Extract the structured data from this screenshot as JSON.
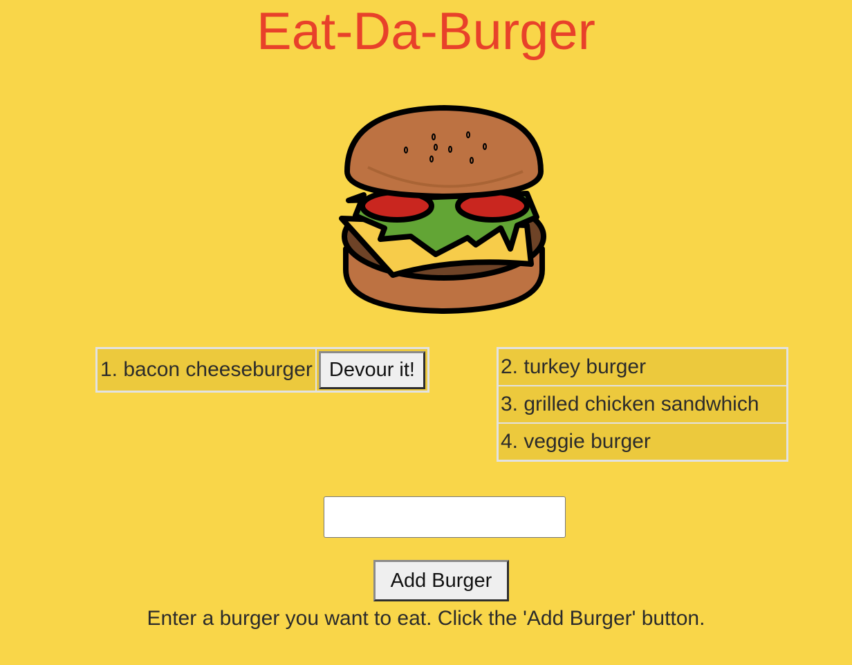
{
  "header": {
    "title": "Eat-Da-Burger"
  },
  "logo": {
    "icon": "burger-icon"
  },
  "not_devoured": {
    "items": [
      {
        "label": "1. bacon cheeseburger",
        "button_label": "Devour it!"
      }
    ]
  },
  "devoured": {
    "items": [
      {
        "label": "2. turkey burger"
      },
      {
        "label": "3. grilled chicken sandwhich"
      },
      {
        "label": "4. veggie burger"
      }
    ]
  },
  "form": {
    "input_value": "",
    "input_placeholder": "",
    "submit_label": "Add Burger",
    "instructions": "Enter a burger you want to eat. Click the 'Add Burger' button."
  },
  "colors": {
    "background": "#f9d649",
    "title": "#e8412a",
    "table_row": "#ecc93d"
  }
}
